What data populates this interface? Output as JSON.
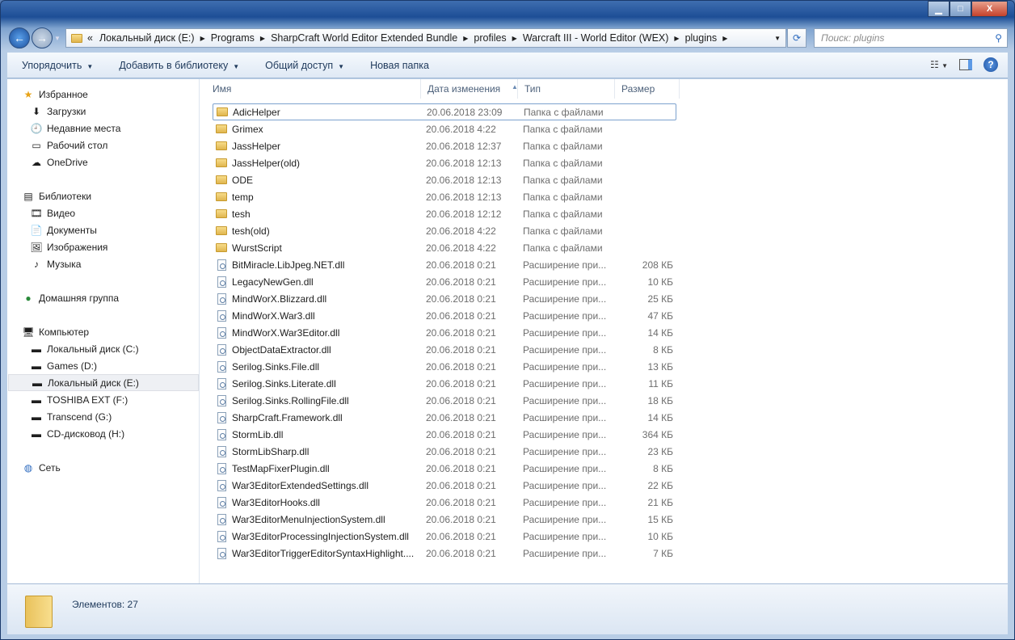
{
  "window": {
    "minimize": "▁",
    "maximize": "□",
    "close": "X"
  },
  "address": {
    "overflow": "«",
    "crumbs": [
      "Локальный диск (E:)",
      "Programs",
      "SharpCraft World Editor Extended Bundle",
      "profiles",
      "Warcraft III - World Editor (WEX)",
      "plugins"
    ]
  },
  "search": {
    "placeholder": "Поиск: plugins"
  },
  "toolbar": {
    "organize": "Упорядочить",
    "add_library": "Добавить в библиотеку",
    "share": "Общий доступ",
    "new_folder": "Новая папка"
  },
  "sidebar": {
    "favorites": {
      "label": "Избранное",
      "items": [
        "Загрузки",
        "Недавние места",
        "Рабочий стол",
        "OneDrive"
      ]
    },
    "libraries": {
      "label": "Библиотеки",
      "items": [
        "Видео",
        "Документы",
        "Изображения",
        "Музыка"
      ]
    },
    "homegroup": "Домашняя группа",
    "computer": {
      "label": "Компьютер",
      "items": [
        "Локальный диск (C:)",
        "Games (D:)",
        "Локальный диск (E:)",
        "TOSHIBA EXT (F:)",
        "Transcend (G:)",
        "CD-дисковод (H:)"
      ]
    },
    "network": "Сеть"
  },
  "columns": {
    "name": "Имя",
    "date": "Дата изменения",
    "type": "Тип",
    "size": "Размер"
  },
  "files": [
    {
      "name": "AdicHelper",
      "date": "20.06.2018 23:09",
      "type": "Папка с файлами",
      "size": "",
      "folder": true
    },
    {
      "name": "Grimex",
      "date": "20.06.2018 4:22",
      "type": "Папка с файлами",
      "size": "",
      "folder": true
    },
    {
      "name": "JassHelper",
      "date": "20.06.2018 12:37",
      "type": "Папка с файлами",
      "size": "",
      "folder": true
    },
    {
      "name": "JassHelper(old)",
      "date": "20.06.2018 12:13",
      "type": "Папка с файлами",
      "size": "",
      "folder": true
    },
    {
      "name": "ODE",
      "date": "20.06.2018 12:13",
      "type": "Папка с файлами",
      "size": "",
      "folder": true
    },
    {
      "name": "temp",
      "date": "20.06.2018 12:13",
      "type": "Папка с файлами",
      "size": "",
      "folder": true
    },
    {
      "name": "tesh",
      "date": "20.06.2018 12:12",
      "type": "Папка с файлами",
      "size": "",
      "folder": true
    },
    {
      "name": "tesh(old)",
      "date": "20.06.2018 4:22",
      "type": "Папка с файлами",
      "size": "",
      "folder": true
    },
    {
      "name": "WurstScript",
      "date": "20.06.2018 4:22",
      "type": "Папка с файлами",
      "size": "",
      "folder": true
    },
    {
      "name": "BitMiracle.LibJpeg.NET.dll",
      "date": "20.06.2018 0:21",
      "type": "Расширение при...",
      "size": "208 КБ"
    },
    {
      "name": "LegacyNewGen.dll",
      "date": "20.06.2018 0:21",
      "type": "Расширение при...",
      "size": "10 КБ"
    },
    {
      "name": "MindWorX.Blizzard.dll",
      "date": "20.06.2018 0:21",
      "type": "Расширение при...",
      "size": "25 КБ"
    },
    {
      "name": "MindWorX.War3.dll",
      "date": "20.06.2018 0:21",
      "type": "Расширение при...",
      "size": "47 КБ"
    },
    {
      "name": "MindWorX.War3Editor.dll",
      "date": "20.06.2018 0:21",
      "type": "Расширение при...",
      "size": "14 КБ"
    },
    {
      "name": "ObjectDataExtractor.dll",
      "date": "20.06.2018 0:21",
      "type": "Расширение при...",
      "size": "8 КБ"
    },
    {
      "name": "Serilog.Sinks.File.dll",
      "date": "20.06.2018 0:21",
      "type": "Расширение при...",
      "size": "13 КБ"
    },
    {
      "name": "Serilog.Sinks.Literate.dll",
      "date": "20.06.2018 0:21",
      "type": "Расширение при...",
      "size": "11 КБ"
    },
    {
      "name": "Serilog.Sinks.RollingFile.dll",
      "date": "20.06.2018 0:21",
      "type": "Расширение при...",
      "size": "18 КБ"
    },
    {
      "name": "SharpCraft.Framework.dll",
      "date": "20.06.2018 0:21",
      "type": "Расширение при...",
      "size": "14 КБ"
    },
    {
      "name": "StormLib.dll",
      "date": "20.06.2018 0:21",
      "type": "Расширение при...",
      "size": "364 КБ"
    },
    {
      "name": "StormLibSharp.dll",
      "date": "20.06.2018 0:21",
      "type": "Расширение при...",
      "size": "23 КБ"
    },
    {
      "name": "TestMapFixerPlugin.dll",
      "date": "20.06.2018 0:21",
      "type": "Расширение при...",
      "size": "8 КБ"
    },
    {
      "name": "War3EditorExtendedSettings.dll",
      "date": "20.06.2018 0:21",
      "type": "Расширение при...",
      "size": "22 КБ"
    },
    {
      "name": "War3EditorHooks.dll",
      "date": "20.06.2018 0:21",
      "type": "Расширение при...",
      "size": "21 КБ"
    },
    {
      "name": "War3EditorMenuInjectionSystem.dll",
      "date": "20.06.2018 0:21",
      "type": "Расширение при...",
      "size": "15 КБ"
    },
    {
      "name": "War3EditorProcessingInjectionSystem.dll",
      "date": "20.06.2018 0:21",
      "type": "Расширение при...",
      "size": "10 КБ"
    },
    {
      "name": "War3EditorTriggerEditorSyntaxHighlight....",
      "date": "20.06.2018 0:21",
      "type": "Расширение при...",
      "size": "7 КБ"
    }
  ],
  "status": {
    "count": "Элементов: 27"
  }
}
